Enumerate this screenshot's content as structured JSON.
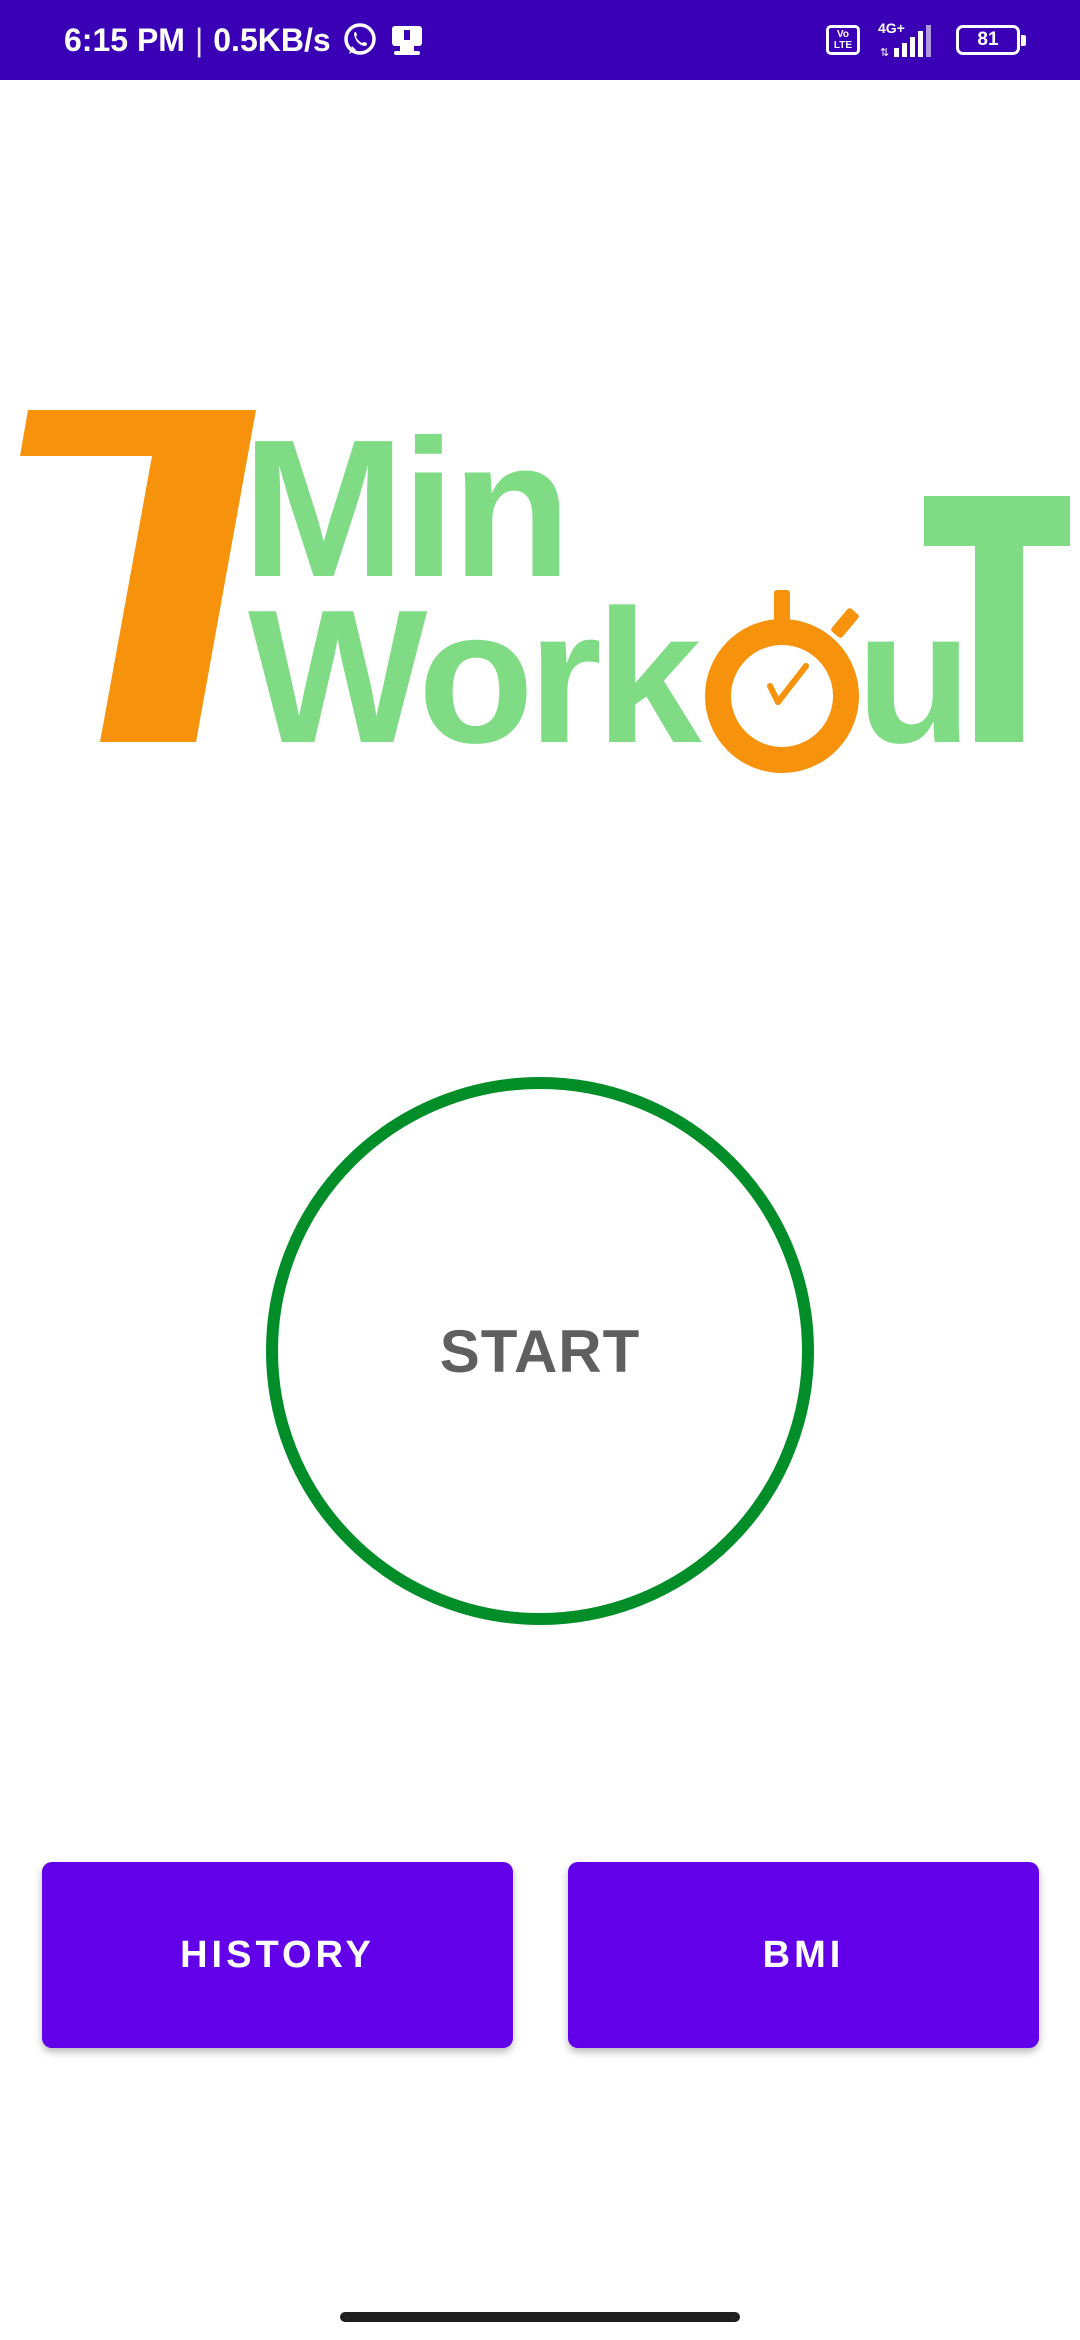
{
  "status_bar": {
    "time": "6:15 PM",
    "separator": "|",
    "network_speed": "0.5KB/s",
    "whatsapp_icon": "whatsapp-icon",
    "notification_icon": "download-notification-icon",
    "volte_label": "Vo LTE",
    "network_type": "4G+",
    "battery_level": "81",
    "background_color": "#3a00b5"
  },
  "logo": {
    "number": "7",
    "line1": "Min",
    "line2_prefix": "Work",
    "line2_suffix": "u",
    "line2_end": "T",
    "orange_color": "#f7920c",
    "green_color": "#7fdc85"
  },
  "start_button": {
    "label": "START",
    "ring_color": "#018d28"
  },
  "buttons": {
    "history_label": "HISTORY",
    "bmi_label": "BMI",
    "color": "#6200ea"
  }
}
